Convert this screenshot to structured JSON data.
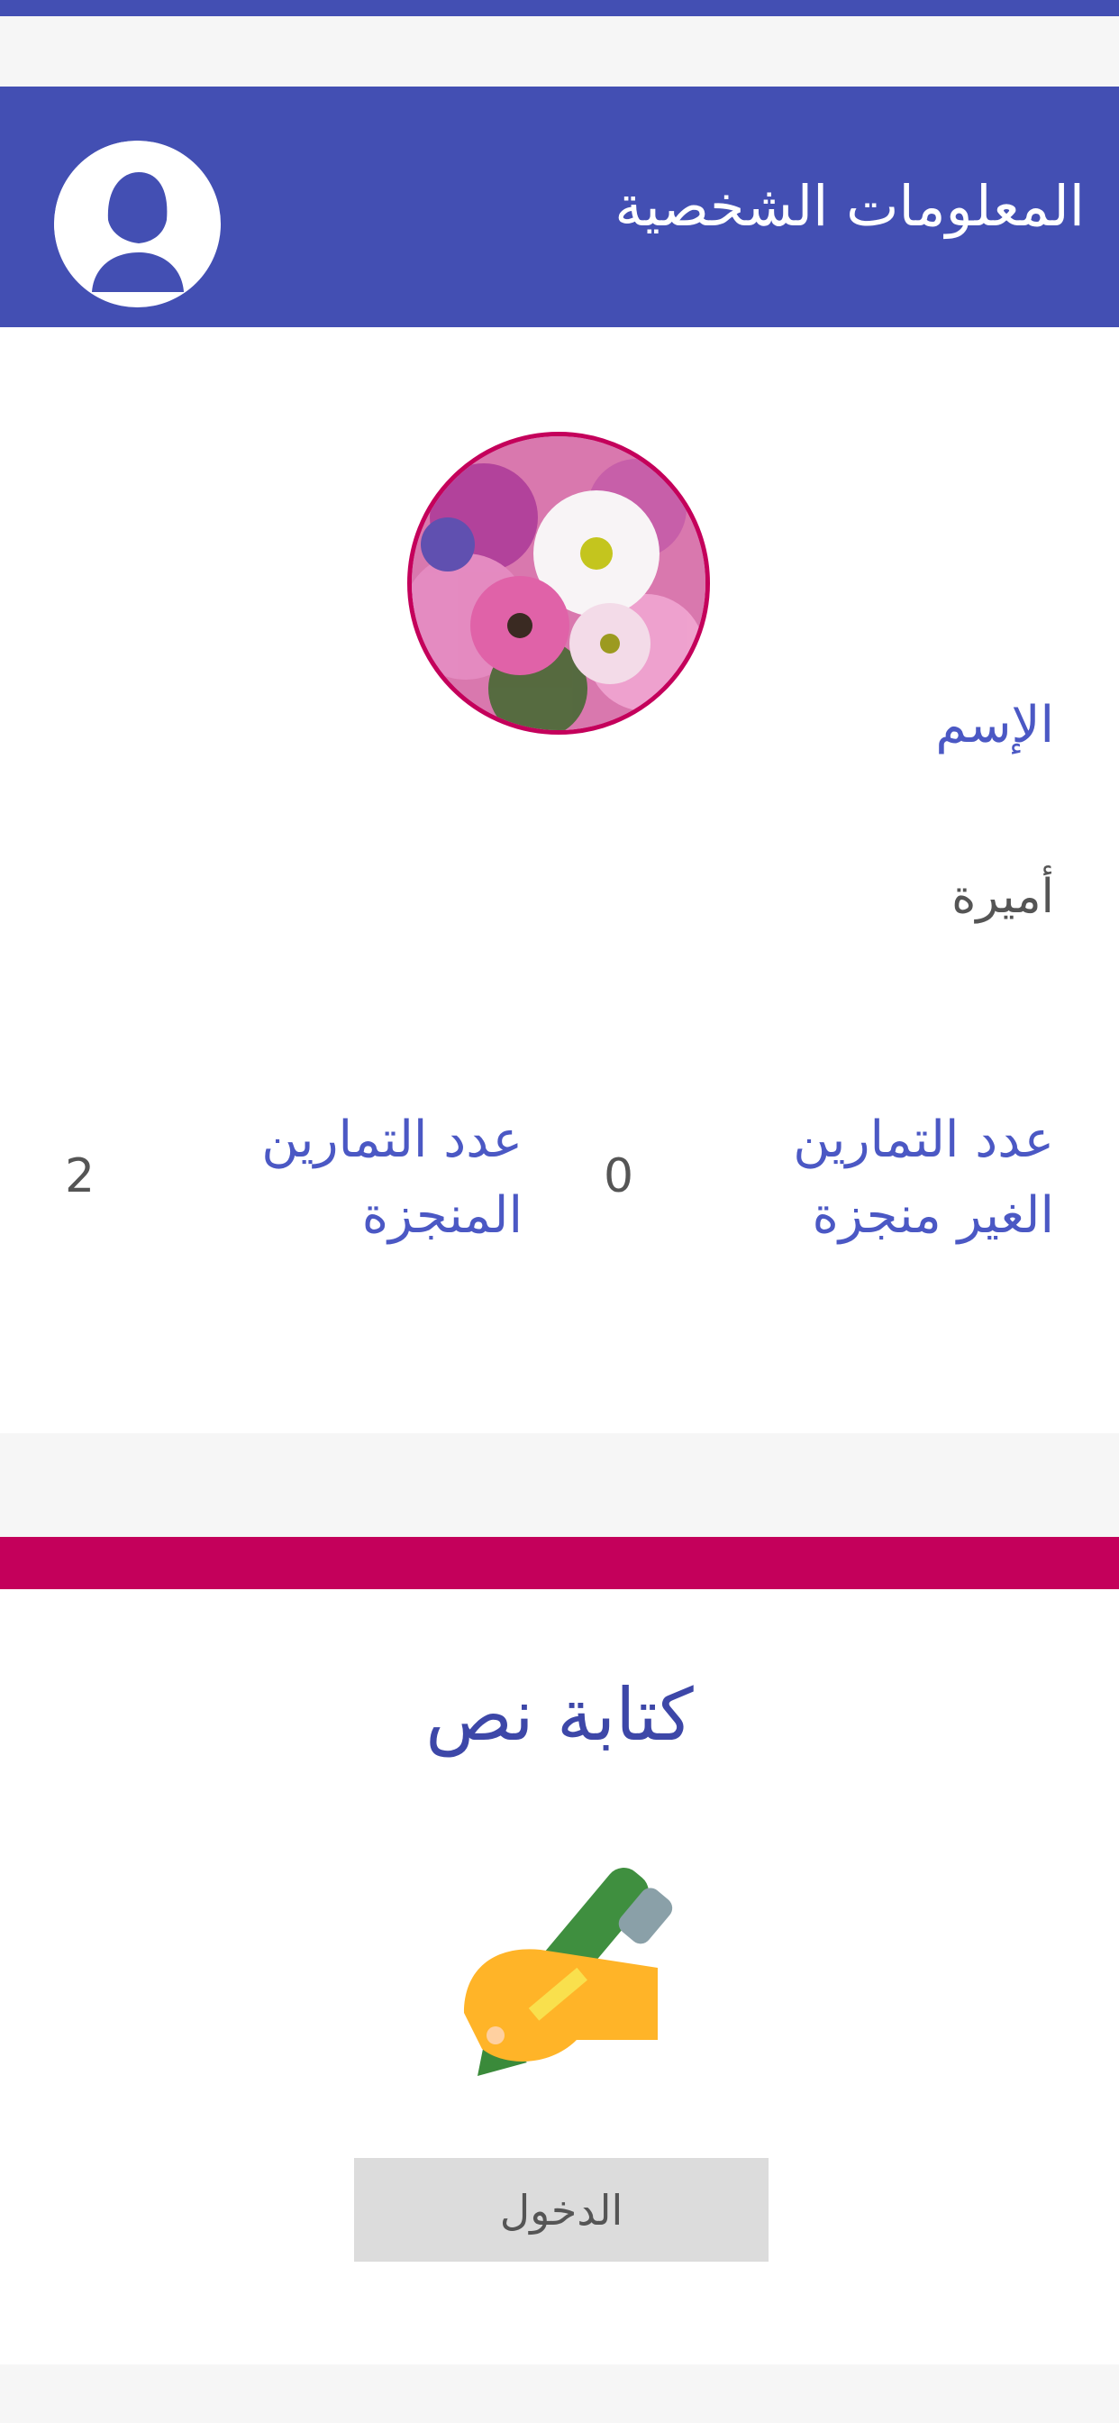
{
  "header": {
    "title": "المعلومات الشخصية",
    "avatar_icon": "user-female-icon"
  },
  "profile": {
    "photo_icon": "flowers-photo",
    "name_label": "الإسم",
    "name_value": "أميرة",
    "pending_label": "عدد التمارين الغير منجزة",
    "pending_value": "0",
    "done_label": "عدد التمارين المنجزة",
    "done_value": "2"
  },
  "exercise": {
    "title": "كتابة نص",
    "icon": "writing-hand-icon",
    "button_label": "الدخول"
  },
  "colors": {
    "primary": "#434fb3",
    "accent": "#c4005b",
    "label": "#4b58c4"
  }
}
